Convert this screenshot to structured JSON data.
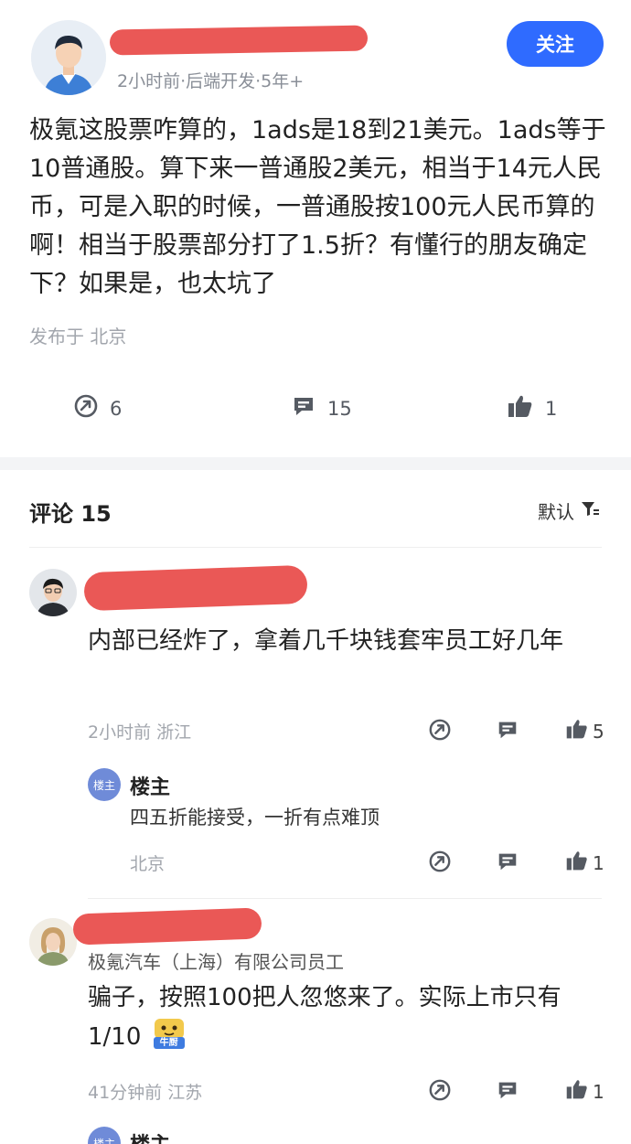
{
  "post": {
    "meta": "2小时前·后端开发·5年+",
    "follow_label": "关注",
    "body": "极氪这股票咋算的，1ads是18到21美元。1ads等于10普通股。算下来一普通股2美元，相当于14元人民币，可是入职的时候，一普通股按100元人民币算的啊！相当于股票部分打了1.5折？有懂行的朋友确定下？如果是，也太坑了",
    "location": "发布于 北京",
    "share_count": "6",
    "comment_count": "15",
    "like_count": "1"
  },
  "comments_header": {
    "title": "评论 15",
    "sort_label": "默认"
  },
  "comments": [
    {
      "text": "内部已经炸了，拿着几千块钱套牢员工好几年",
      "meta": "2小时前 浙江",
      "like_count": "5",
      "reply": {
        "badge": "楼主",
        "name": "楼主",
        "text": "四五折能接受，一折有点难顶",
        "meta": "北京",
        "like_count": "1"
      }
    },
    {
      "company": "极氪汽车（上海）有限公司员工",
      "text": "骗子，按照100把人忽悠来了。实际上市只有1/10",
      "emoji_label": "牛厨",
      "meta": "41分钟前 江苏",
      "like_count": "1",
      "reply": {
        "badge": "楼主",
        "name": "楼主"
      }
    }
  ],
  "colors": {
    "accent": "#2f6bff",
    "redaction": "#e84a48"
  }
}
